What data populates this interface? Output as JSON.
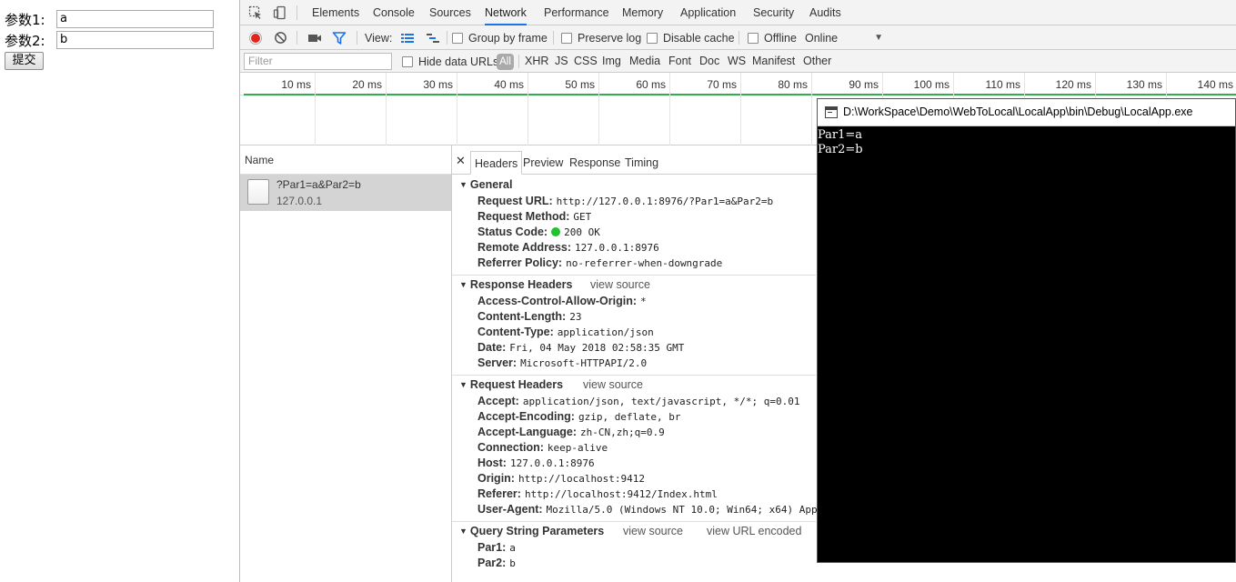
{
  "webpage": {
    "param1_label": "参数1:",
    "param1_value": "a",
    "param2_label": "参数2:",
    "param2_value": "b",
    "submit_label": "提交"
  },
  "devtools": {
    "tabs": [
      "Elements",
      "Console",
      "Sources",
      "Network",
      "Performance",
      "Memory",
      "Application",
      "Security",
      "Audits"
    ],
    "active_tab": "Network",
    "toolbar": {
      "view_label": "View:",
      "group_by_frame": "Group by frame",
      "preserve_log": "Preserve log",
      "disable_cache": "Disable cache",
      "offline": "Offline",
      "throttle": "Online"
    },
    "filter": {
      "placeholder": "Filter",
      "hide_data_urls": "Hide data URLs",
      "types": [
        "All",
        "XHR",
        "JS",
        "CSS",
        "Img",
        "Media",
        "Font",
        "Doc",
        "WS",
        "Manifest",
        "Other"
      ]
    },
    "timeline_ticks": [
      "10 ms",
      "20 ms",
      "30 ms",
      "40 ms",
      "50 ms",
      "60 ms",
      "70 ms",
      "80 ms",
      "90 ms",
      "100 ms",
      "110 ms",
      "120 ms",
      "130 ms",
      "140 ms"
    ],
    "name_header": "Name",
    "request": {
      "name": "?Par1=a&Par2=b",
      "host": "127.0.0.1"
    },
    "detail_tabs": [
      "Headers",
      "Preview",
      "Response",
      "Timing"
    ],
    "general": {
      "title": "General",
      "rows": [
        {
          "k": "Request URL:",
          "v": "http://127.0.0.1:8976/?Par1=a&Par2=b"
        },
        {
          "k": "Request Method:",
          "v": "GET"
        },
        {
          "k": "Status Code:",
          "v": "200 OK"
        },
        {
          "k": "Remote Address:",
          "v": "127.0.0.1:8976"
        },
        {
          "k": "Referrer Policy:",
          "v": "no-referrer-when-downgrade"
        }
      ]
    },
    "response_headers": {
      "title": "Response Headers",
      "view_source": "view source",
      "rows": [
        {
          "k": "Access-Control-Allow-Origin:",
          "v": "*"
        },
        {
          "k": "Content-Length:",
          "v": "23"
        },
        {
          "k": "Content-Type:",
          "v": "application/json"
        },
        {
          "k": "Date:",
          "v": "Fri, 04 May 2018 02:58:35 GMT"
        },
        {
          "k": "Server:",
          "v": "Microsoft-HTTPAPI/2.0"
        }
      ]
    },
    "request_headers": {
      "title": "Request Headers",
      "view_source": "view source",
      "rows": [
        {
          "k": "Accept:",
          "v": "application/json, text/javascript, */*; q=0.01"
        },
        {
          "k": "Accept-Encoding:",
          "v": "gzip, deflate, br"
        },
        {
          "k": "Accept-Language:",
          "v": "zh-CN,zh;q=0.9"
        },
        {
          "k": "Connection:",
          "v": "keep-alive"
        },
        {
          "k": "Host:",
          "v": "127.0.0.1:8976"
        },
        {
          "k": "Origin:",
          "v": "http://localhost:9412"
        },
        {
          "k": "Referer:",
          "v": "http://localhost:9412/Index.html"
        },
        {
          "k": "User-Agent:",
          "v": "Mozilla/5.0 (Windows NT 10.0; Win64; x64) App"
        }
      ]
    },
    "query_params": {
      "title": "Query String Parameters",
      "view_source": "view source",
      "view_url_encoded": "view URL encoded",
      "rows": [
        {
          "k": "Par1:",
          "v": "a"
        },
        {
          "k": "Par2:",
          "v": "b"
        }
      ]
    }
  },
  "console_window": {
    "title": "D:\\WorkSpace\\Demo\\WebToLocal\\LocalApp\\bin\\Debug\\LocalApp.exe",
    "lines": [
      "Par1=a",
      "Par2=b"
    ]
  }
}
